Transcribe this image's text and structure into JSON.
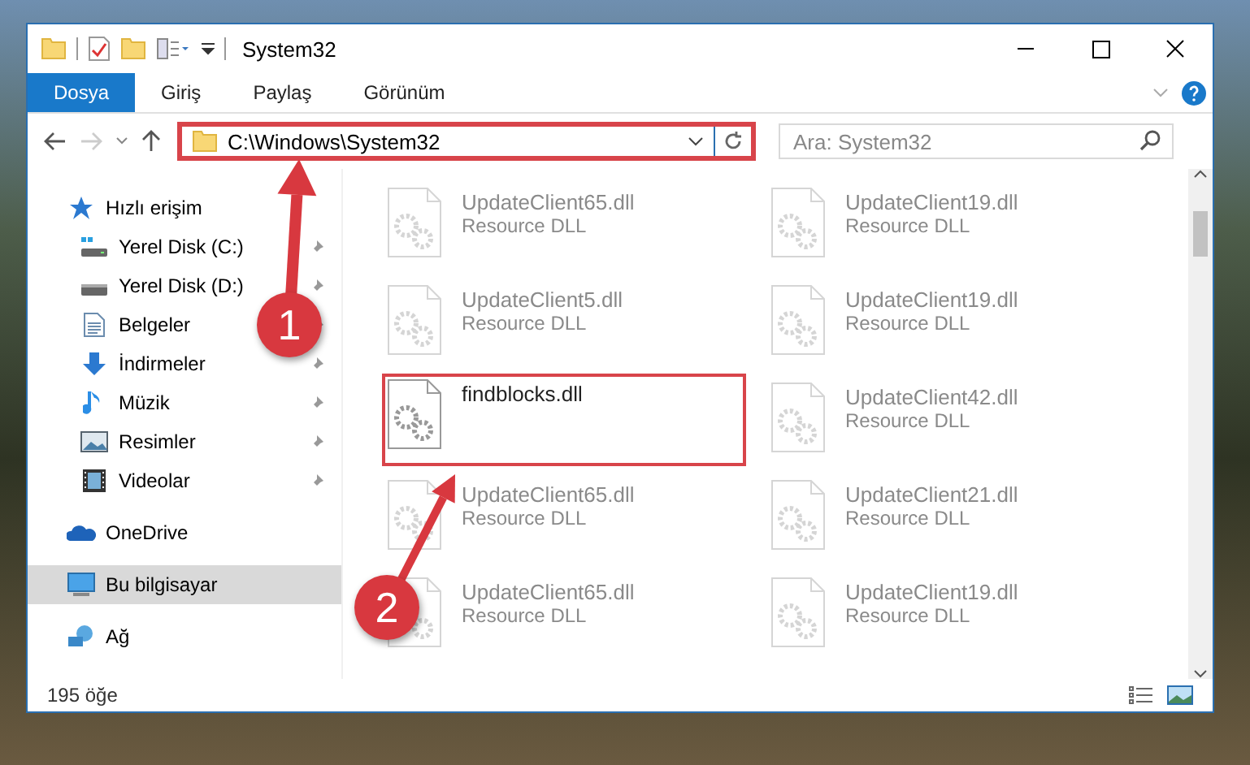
{
  "window": {
    "title": "System32"
  },
  "ribbon": {
    "tabs": [
      {
        "label": "Dosya",
        "selected": true
      },
      {
        "label": "Giriş",
        "selected": false
      },
      {
        "label": "Paylaş",
        "selected": false
      },
      {
        "label": "Görünüm",
        "selected": false
      }
    ]
  },
  "address_bar": {
    "path": "C:\\Windows\\System32",
    "highlighted": true
  },
  "search": {
    "placeholder": "Ara: System32"
  },
  "sidebar": {
    "items": [
      {
        "label": "Hızlı erişim",
        "kind": "star",
        "selected": false,
        "children": [
          {
            "label": "Yerel Disk (C:)",
            "kind": "drive-system",
            "pinned": true,
            "selected": false
          },
          {
            "label": "Yerel Disk (D:)",
            "kind": "drive",
            "pinned": true,
            "selected": false
          },
          {
            "label": "Belgeler",
            "kind": "documents",
            "pinned": true,
            "selected": false
          },
          {
            "label": "İndirmeler",
            "kind": "downloads",
            "pinned": true,
            "selected": false
          },
          {
            "label": "Müzik",
            "kind": "music",
            "pinned": true,
            "selected": false
          },
          {
            "label": "Resimler",
            "kind": "pictures",
            "pinned": true,
            "selected": false
          },
          {
            "label": "Videolar",
            "kind": "videos",
            "pinned": true,
            "selected": false
          }
        ]
      },
      {
        "label": "OneDrive",
        "kind": "cloud",
        "selected": false
      },
      {
        "label": "Bu bilgisayar",
        "kind": "computer",
        "selected": true
      },
      {
        "label": "Ağ",
        "kind": "network",
        "selected": false
      }
    ]
  },
  "files": [
    {
      "name": "UpdateClient65.dll",
      "type": "Resource DLL",
      "blurred": true,
      "highlighted": false
    },
    {
      "name": "UpdateClient19.dll",
      "type": "Resource DLL",
      "blurred": true,
      "highlighted": false
    },
    {
      "name": "UpdateClient5.dll",
      "type": "Resource DLL",
      "blurred": true,
      "highlighted": false
    },
    {
      "name": "UpdateClient19.dll",
      "type": "Resource DLL",
      "blurred": true,
      "highlighted": false
    },
    {
      "name": "findblocks.dll",
      "blurred": false,
      "highlighted": true
    },
    {
      "name": "UpdateClient42.dll",
      "type": "Resource DLL",
      "blurred": true,
      "highlighted": false
    },
    {
      "name": "UpdateClient65.dll",
      "type": "Resource DLL",
      "blurred": true,
      "highlighted": false
    },
    {
      "name": "UpdateClient21.dll",
      "type": "Resource DLL",
      "blurred": true,
      "highlighted": false
    },
    {
      "name": "UpdateClient65.dll",
      "type": "Resource DLL",
      "blurred": true,
      "highlighted": false
    },
    {
      "name": "UpdateClient19.dll",
      "type": "Resource DLL",
      "blurred": true,
      "highlighted": false
    }
  ],
  "status_bar": {
    "item_count": "195 öğe"
  },
  "annotations": [
    {
      "label": "1"
    },
    {
      "label": "2"
    }
  ]
}
